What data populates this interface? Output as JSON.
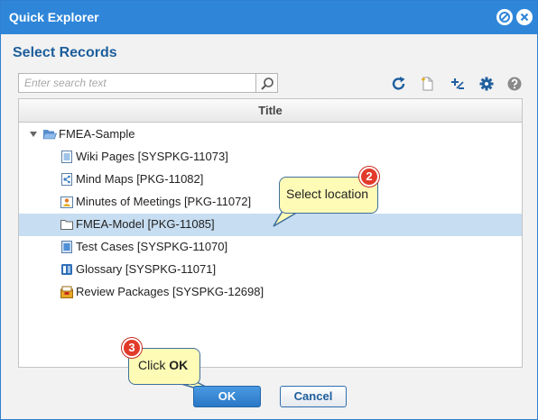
{
  "window": {
    "title": "Quick Explorer"
  },
  "dialog": {
    "heading": "Select Records"
  },
  "search": {
    "placeholder": "Enter search text",
    "value": ""
  },
  "toolbar": {
    "icons": [
      "refresh-icon",
      "new-document-icon",
      "add-remove-icon",
      "settings-gear-icon",
      "help-icon"
    ]
  },
  "grid": {
    "column_header": "Title",
    "root": {
      "label": "FMEA-Sample",
      "icon": "open-folder-icon",
      "expanded": true
    },
    "items": [
      {
        "label": "Wiki Pages [SYSPKG-11073]",
        "icon": "wiki-pages-icon"
      },
      {
        "label": "Mind Maps [PKG-11082]",
        "icon": "mind-map-icon"
      },
      {
        "label": "Minutes of Meetings [PKG-11072]",
        "icon": "meeting-icon"
      },
      {
        "label": "FMEA-Model [PKG-11085]",
        "icon": "folder-icon",
        "selected": true
      },
      {
        "label": "Test Cases [SYSPKG-11070]",
        "icon": "test-cases-icon"
      },
      {
        "label": "Glossary [SYSPKG-11071]",
        "icon": "glossary-icon"
      },
      {
        "label": "Review Packages [SYSPKG-12698]",
        "icon": "review-package-icon"
      }
    ]
  },
  "callouts": {
    "location": {
      "badge": "2",
      "text": "Select location"
    },
    "ok": {
      "badge": "3",
      "prefix": "Click ",
      "bold": "OK"
    }
  },
  "footer": {
    "ok_label": "OK",
    "cancel_label": "Cancel"
  },
  "colors": {
    "titlebar": "#2f86d9",
    "selection": "#c7ddf1",
    "callout": "#fefbb6",
    "badge": "#e23a2a"
  }
}
